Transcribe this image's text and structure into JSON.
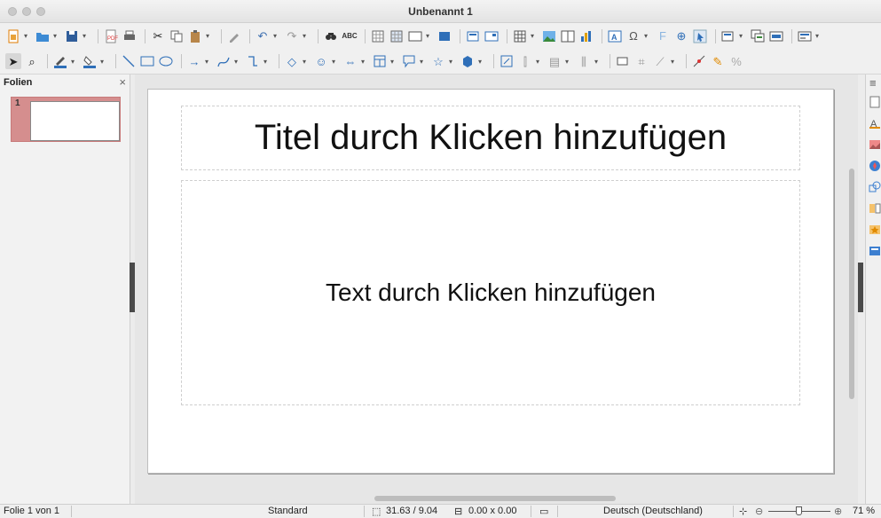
{
  "window": {
    "title": "Unbenannt 1"
  },
  "slides_panel": {
    "title": "Folien",
    "close_glyph": "×",
    "slides": [
      {
        "number": "1"
      }
    ]
  },
  "slide": {
    "title_placeholder": "Titel durch Klicken hinzufügen",
    "body_placeholder": "Text durch Klicken hinzufügen"
  },
  "status": {
    "slide_counter": "Folie 1 von 1",
    "master": "Standard",
    "position": "31.63 / 9.04",
    "size": "0.00 x 0.00",
    "language": "Deutsch (Deutschland)",
    "zoom": "71 %",
    "zoom_level": 0.71
  },
  "toolbar1": {
    "icons": [
      "new-icon",
      "open-icon",
      "save-icon",
      "export-pdf-icon",
      "print-icon",
      "cut-icon",
      "copy-icon",
      "paste-icon",
      "clone-formatting-icon",
      "undo-icon",
      "redo-icon",
      "find-replace-icon",
      "spelling-icon",
      "display-grid-icon",
      "helplines-icon",
      "display-views-icon",
      "master-slide-icon",
      "slide-layout-icon",
      "start-presentation-icon",
      "table-icon",
      "image-icon",
      "media-icon",
      "chart-icon",
      "textbox-icon",
      "special-character-icon",
      "fontwork-icon",
      "hyperlink-icon",
      "interaction-icon",
      "show-draw-functions-icon",
      "new-slide-icon",
      "duplicate-slide-icon",
      "delete-slide-icon",
      "slide-layout-menu-icon"
    ]
  },
  "toolbar2": {
    "icons": [
      "select-icon",
      "zoom-pan-icon",
      "line-color-icon",
      "fill-color-icon",
      "line-icon",
      "rectangle-icon",
      "ellipse-icon",
      "line-arrow-icon",
      "curve-icon",
      "connector-icon",
      "basic-shapes-icon",
      "symbol-shapes-icon",
      "block-arrows-icon",
      "flowchart-icon",
      "callouts-icon",
      "stars-icon",
      "3d-objects-icon",
      "rotate-icon",
      "align-icon",
      "arrange-icon",
      "distribute-icon",
      "shadow-icon",
      "crop-icon",
      "filter-icon",
      "points-icon",
      "glue-points-icon",
      "toggle-extrusion-icon"
    ]
  },
  "colors": {
    "accent": "#d58e8e",
    "selection_border": "#c77a7a"
  }
}
